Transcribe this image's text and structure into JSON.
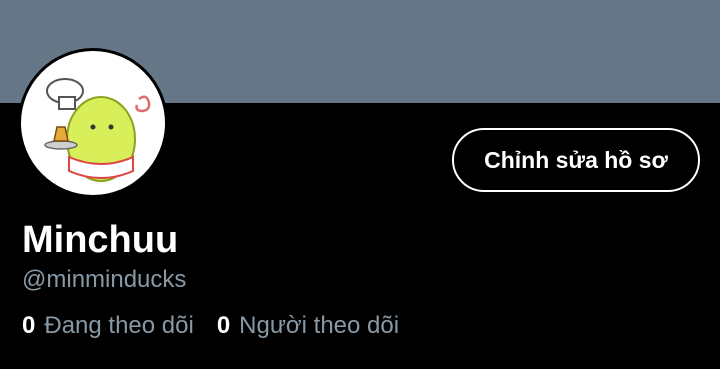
{
  "profile": {
    "display_name": "Minchuu",
    "handle": "@minminducks",
    "edit_label": "Chỉnh sửa hồ sơ"
  },
  "stats": {
    "following_count": "0",
    "following_label": "Đang theo dõi",
    "followers_count": "0",
    "followers_label": "Người theo dõi"
  },
  "colors": {
    "banner": "#657786",
    "background": "#000000",
    "secondary_text": "#8899a6"
  }
}
